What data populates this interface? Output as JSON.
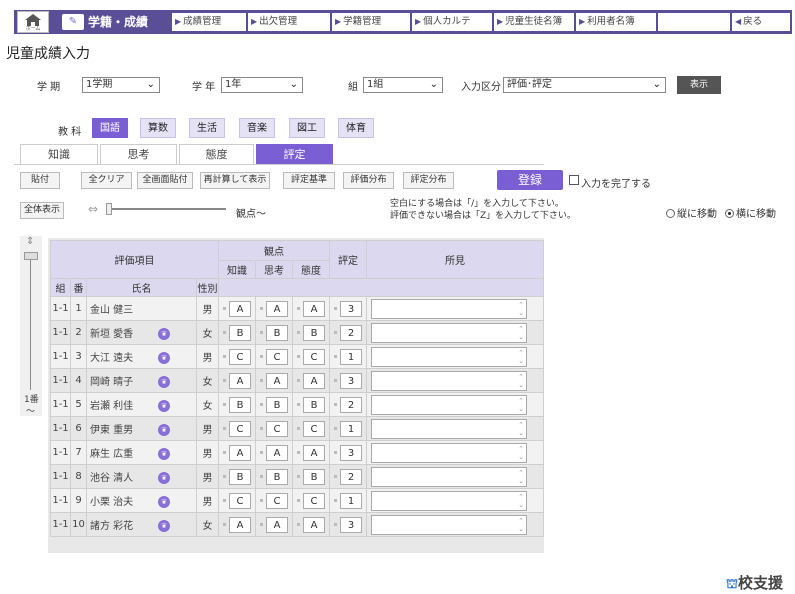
{
  "nav": {
    "home_label": "ホーム",
    "brand": "学籍・成績",
    "items": [
      {
        "label": "成績管理"
      },
      {
        "label": "出欠管理"
      },
      {
        "label": "学籍管理"
      },
      {
        "label": "個人カルテ"
      },
      {
        "label": "児童生徒名簿"
      },
      {
        "label": "利用者名簿"
      },
      {
        "label": ""
      }
    ],
    "back_label": "戻る"
  },
  "page_title": "児童成績入力",
  "filters": {
    "term_label": "学 期",
    "term_value": "1学期",
    "grade_label": "学 年",
    "grade_value": "1年",
    "class_label": "組",
    "class_value": "1組",
    "input_type_label": "入力区分",
    "input_type_value": "評価･評定",
    "show_button": "表示"
  },
  "subjects": {
    "label": "教 科",
    "items": [
      "国語",
      "算数",
      "生活",
      "音楽",
      "図工",
      "体育"
    ],
    "active": "国語"
  },
  "tabs": {
    "items": [
      "知識",
      "思考",
      "態度",
      "評定"
    ],
    "active": "評定"
  },
  "toolbar": {
    "buttons": [
      "貼付",
      "全クリア",
      "全画面貼付",
      "再計算して表示",
      "評定基準",
      "評価分布",
      "評定分布"
    ],
    "register": "登録",
    "complete_label": "入力を完了する"
  },
  "view": {
    "all_button": "全体表示",
    "viewpoint_label": "観点～",
    "note1": "空白にする場合は「/」を入力して下さい。",
    "note2": "評価できない場合は「Z」を入力して下さい。",
    "move_vertical": "縦に移動",
    "move_horizontal": "横に移動",
    "move_selected": "横に移動",
    "left_pos_label": "1番",
    "left_tilde": "～"
  },
  "table": {
    "headers": {
      "item": "評価項目",
      "viewpoint": "観点",
      "class": "組",
      "num": "番",
      "name": "氏名",
      "gender": "性別",
      "knowledge": "知識",
      "thinking": "思考",
      "attitude": "態度",
      "grade": "評定",
      "remarks": "所見"
    },
    "rows": [
      {
        "cls": "1-1",
        "num": "1",
        "name": "金山 健三",
        "icon": false,
        "gender": "男",
        "k": "A",
        "t": "A",
        "a": "A",
        "g": "3"
      },
      {
        "cls": "1-1",
        "num": "2",
        "name": "新垣 愛香",
        "icon": true,
        "gender": "女",
        "k": "B",
        "t": "B",
        "a": "B",
        "g": "2"
      },
      {
        "cls": "1-1",
        "num": "3",
        "name": "大江 遠夫",
        "icon": true,
        "gender": "男",
        "k": "C",
        "t": "C",
        "a": "C",
        "g": "1"
      },
      {
        "cls": "1-1",
        "num": "4",
        "name": "岡崎 晴子",
        "icon": true,
        "gender": "女",
        "k": "A",
        "t": "A",
        "a": "A",
        "g": "3"
      },
      {
        "cls": "1-1",
        "num": "5",
        "name": "岩瀬 利佳",
        "icon": true,
        "gender": "女",
        "k": "B",
        "t": "B",
        "a": "B",
        "g": "2"
      },
      {
        "cls": "1-1",
        "num": "6",
        "name": "伊東 重男",
        "icon": true,
        "gender": "男",
        "k": "C",
        "t": "C",
        "a": "C",
        "g": "1"
      },
      {
        "cls": "1-1",
        "num": "7",
        "name": "麻生 広重",
        "icon": true,
        "gender": "男",
        "k": "A",
        "t": "A",
        "a": "A",
        "g": "3"
      },
      {
        "cls": "1-1",
        "num": "8",
        "name": "池谷 清人",
        "icon": true,
        "gender": "男",
        "k": "B",
        "t": "B",
        "a": "B",
        "g": "2"
      },
      {
        "cls": "1-1",
        "num": "9",
        "name": "小栗 治夫",
        "icon": true,
        "gender": "男",
        "k": "C",
        "t": "C",
        "a": "C",
        "g": "1"
      },
      {
        "cls": "1-1",
        "num": "10",
        "name": "諸方 彩花",
        "icon": true,
        "gender": "女",
        "k": "A",
        "t": "A",
        "a": "A",
        "g": "3"
      }
    ]
  },
  "footer_brand": "校支援",
  "colors": {
    "nav": "#5a4e97",
    "accent": "#7a5fd4",
    "header_bg": "#dcd8ef"
  }
}
